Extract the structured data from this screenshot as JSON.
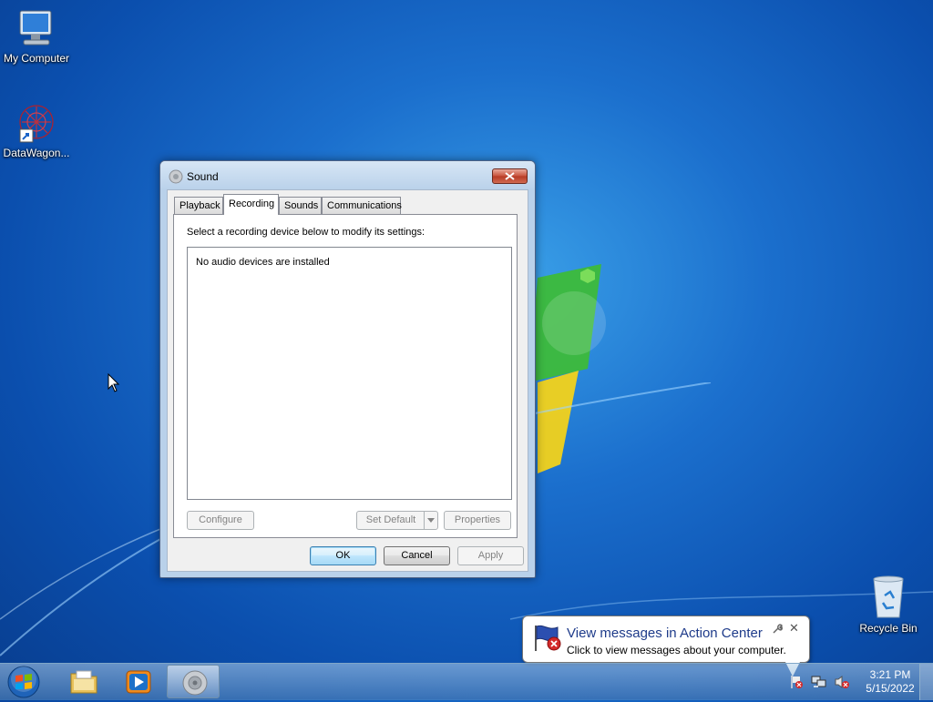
{
  "desktop": {
    "icons": [
      {
        "label": "My Computer"
      },
      {
        "label": "DataWagon..."
      },
      {
        "label": "Recycle Bin"
      }
    ]
  },
  "dialog": {
    "title": "Sound",
    "tabs": [
      {
        "label": "Playback",
        "active": false
      },
      {
        "label": "Recording",
        "active": true
      },
      {
        "label": "Sounds",
        "active": false
      },
      {
        "label": "Communications",
        "active": false
      }
    ],
    "instruction": "Select a recording device below to modify its settings:",
    "device_list_empty": "No audio devices are installed",
    "buttons": {
      "configure": "Configure",
      "set_default": "Set Default",
      "properties": "Properties",
      "ok": "OK",
      "cancel": "Cancel",
      "apply": "Apply"
    }
  },
  "taskbar": {
    "items": [
      "start-button",
      "windows-explorer",
      "windows-media-player",
      "sound"
    ],
    "clock": {
      "time": "3:21 PM",
      "date": "5/15/2022"
    }
  },
  "balloon": {
    "title": "View messages in Action Center",
    "text": "Click to view messages about your computer."
  },
  "colors": {
    "desktop_blue": "#1b6fcd",
    "balloon_title": "#1e3b8a",
    "close_red": "#c7503a"
  }
}
